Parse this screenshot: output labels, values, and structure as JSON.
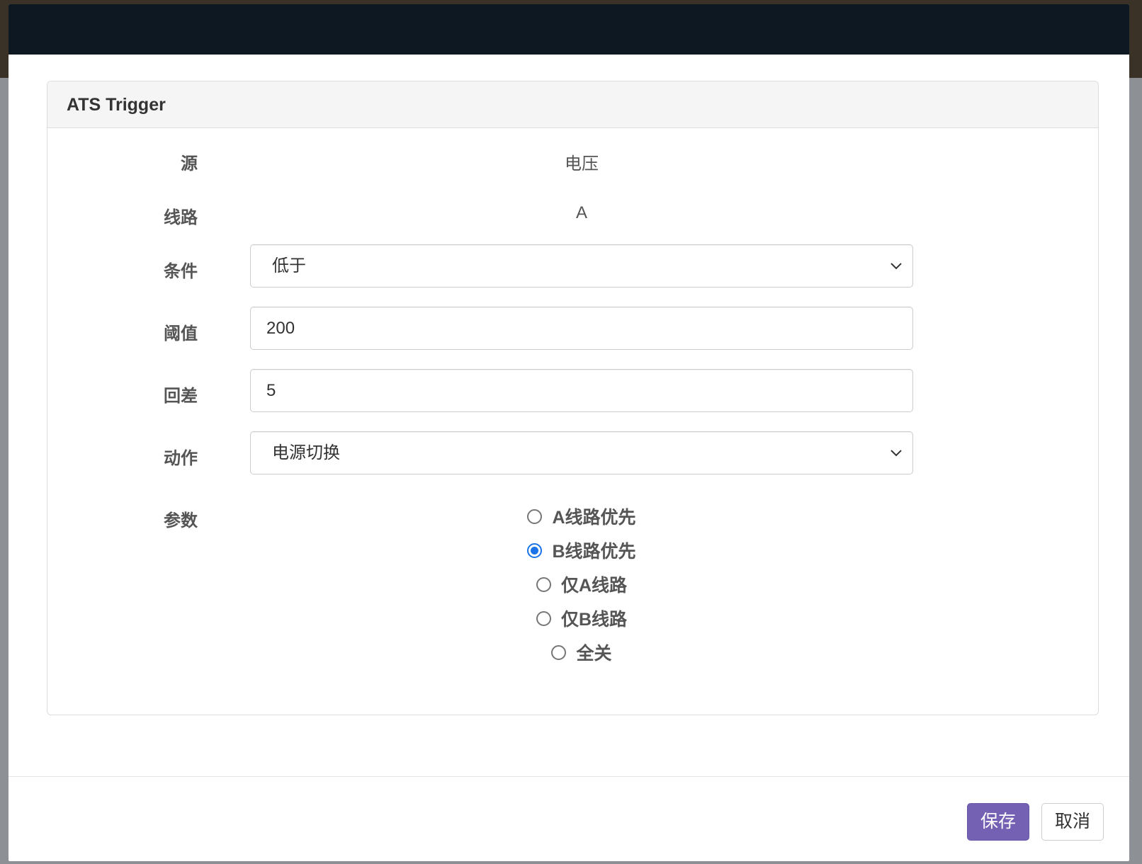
{
  "panel": {
    "title": "ATS Trigger"
  },
  "form": {
    "source": {
      "label": "源",
      "value": "电压"
    },
    "line": {
      "label": "线路",
      "value": "A"
    },
    "condition": {
      "label": "条件",
      "selected": "低于"
    },
    "threshold": {
      "label": "阈值",
      "value": "200"
    },
    "hysteresis": {
      "label": "回差",
      "value": "5"
    },
    "action": {
      "label": "动作",
      "selected": "电源切换"
    },
    "params": {
      "label": "参数",
      "options": [
        {
          "label": "A线路优先",
          "checked": false
        },
        {
          "label": "B线路优先",
          "checked": true
        },
        {
          "label": "仅A线路",
          "checked": false
        },
        {
          "label": "仅B线路",
          "checked": false
        },
        {
          "label": "全关",
          "checked": false
        }
      ]
    }
  },
  "footer": {
    "save_label": "保存",
    "cancel_label": "取消"
  },
  "colors": {
    "primary": "#7461b3",
    "header": "#0e1822",
    "radio_checked": "#1a73e8"
  }
}
